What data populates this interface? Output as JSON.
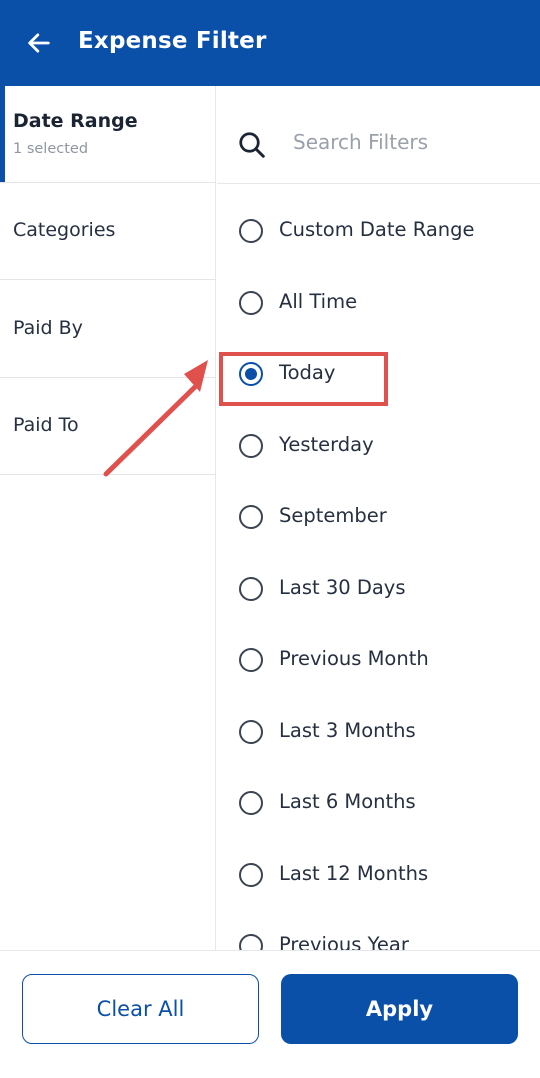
{
  "header": {
    "title": "Expense Filter",
    "back_icon": "arrow-left-icon"
  },
  "colors": {
    "primary": "#0a4fa8",
    "annotation": "#e0504c"
  },
  "sidebar": {
    "items": [
      {
        "label": "Date Range",
        "sub": "1 selected",
        "active": true
      },
      {
        "label": "Categories"
      },
      {
        "label": "Paid By"
      },
      {
        "label": "Paid To"
      }
    ]
  },
  "search": {
    "placeholder": "Search Filters",
    "value": ""
  },
  "options": [
    {
      "label": "Custom Date Range",
      "selected": false
    },
    {
      "label": "All Time",
      "selected": false
    },
    {
      "label": "Today",
      "selected": true
    },
    {
      "label": "Yesterday",
      "selected": false
    },
    {
      "label": "September",
      "selected": false
    },
    {
      "label": "Last 30 Days",
      "selected": false
    },
    {
      "label": "Previous Month",
      "selected": false
    },
    {
      "label": "Last 3 Months",
      "selected": false
    },
    {
      "label": "Last 6 Months",
      "selected": false
    },
    {
      "label": "Last 12 Months",
      "selected": false
    },
    {
      "label": "Previous Year",
      "selected": false
    }
  ],
  "footer": {
    "clear_label": "Clear All",
    "apply_label": "Apply"
  }
}
